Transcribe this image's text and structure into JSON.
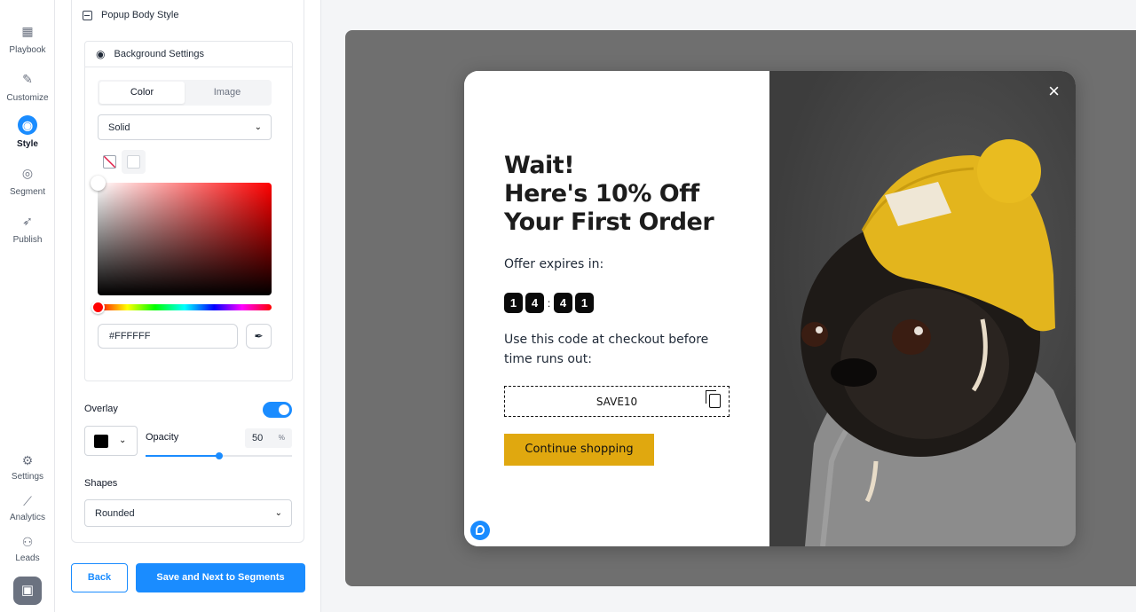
{
  "nav": {
    "items": [
      {
        "label": "Playbook",
        "icon": "grid-icon",
        "glyph": "▦"
      },
      {
        "label": "Customize",
        "icon": "pencil-icon",
        "glyph": "✎"
      },
      {
        "label": "Style",
        "icon": "palette-icon",
        "glyph": "◉"
      },
      {
        "label": "Segment",
        "icon": "target-icon",
        "glyph": "◎"
      },
      {
        "label": "Publish",
        "icon": "rocket-icon",
        "glyph": "➶"
      }
    ],
    "bottom": [
      {
        "label": "Settings",
        "icon": "gear-icon",
        "glyph": "⚙"
      },
      {
        "label": "Analytics",
        "icon": "chart-line-icon",
        "glyph": "⟋"
      },
      {
        "label": "Leads",
        "icon": "users-icon",
        "glyph": "⚇"
      }
    ],
    "active": "Style"
  },
  "panel": {
    "section_title": "Popup Body Style",
    "background": {
      "title": "Background Settings",
      "tabs": [
        "Color",
        "Image"
      ],
      "active_tab": "Color",
      "fill_type": "Solid",
      "hex_value": "#FFFFFF"
    },
    "overlay": {
      "label": "Overlay",
      "enabled": true,
      "opacity_label": "Opacity",
      "opacity_value": "50",
      "opacity_unit": "%",
      "color": "#000000"
    },
    "shapes": {
      "label": "Shapes",
      "value": "Rounded"
    },
    "buttons": {
      "back": "Back",
      "next": "Save and Next to Segments"
    }
  },
  "popup": {
    "headline": [
      "Wait!",
      "Here's 10% Off",
      "Your First Order"
    ],
    "expires_label": "Offer expires in:",
    "timer": [
      "1",
      "4",
      "4",
      "1"
    ],
    "timer_separator": ":",
    "instructions": "Use this code at checkout before time runs out:",
    "coupon_code": "SAVE10",
    "cta": "Continue shopping",
    "close_glyph": "×"
  },
  "colors": {
    "accent": "#1a8cff",
    "cta": "#e0a80f",
    "stage": "#6f6f6f"
  }
}
